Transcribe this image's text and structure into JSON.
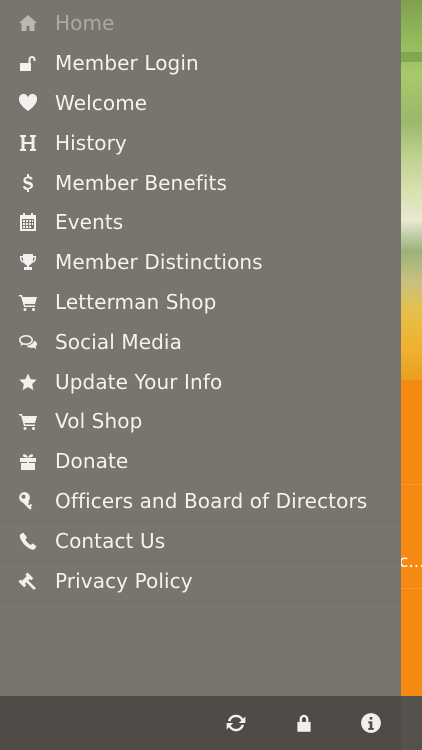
{
  "menu": {
    "items": [
      {
        "label": "Home",
        "icon": "home-icon"
      },
      {
        "label": "Member Login",
        "icon": "unlock-icon"
      },
      {
        "label": "Welcome",
        "icon": "heart-icon"
      },
      {
        "label": "History",
        "icon": "h-letter-icon"
      },
      {
        "label": "Member Benefits",
        "icon": "dollar-icon"
      },
      {
        "label": "Events",
        "icon": "calendar-icon"
      },
      {
        "label": "Member Distinctions",
        "icon": "trophy-icon"
      },
      {
        "label": "Letterman Shop",
        "icon": "cart-icon"
      },
      {
        "label": "Social Media",
        "icon": "chat-bubbles-icon"
      },
      {
        "label": "Update Your Info",
        "icon": "star-icon"
      },
      {
        "label": "Vol Shop",
        "icon": "cart-icon"
      },
      {
        "label": "Donate",
        "icon": "gift-icon"
      },
      {
        "label": "Officers and Board of Directors",
        "icon": "key-icon"
      },
      {
        "label": "Contact Us",
        "icon": "phone-icon"
      },
      {
        "label": "Privacy Policy",
        "icon": "gavel-icon"
      }
    ]
  },
  "toolbar": {
    "icons": [
      "refresh-icon",
      "lock-icon",
      "info-icon"
    ]
  },
  "background": {
    "truncated_text": "c..."
  },
  "colors": {
    "drawer": "#78746e",
    "toolbar": "#4f4c48",
    "accent_orange": "#f58a12"
  }
}
